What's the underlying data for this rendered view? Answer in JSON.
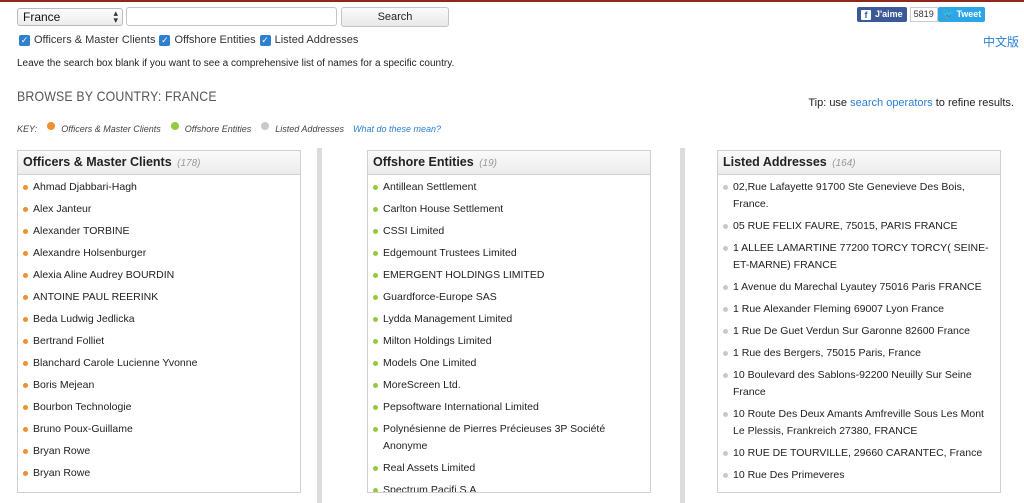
{
  "search": {
    "country_selected": "France",
    "query_value": "",
    "query_placeholder": "",
    "button_label": "Search"
  },
  "filters": [
    {
      "label": "Officers & Master Clients",
      "checked": true
    },
    {
      "label": "Offshore Entities",
      "checked": true
    },
    {
      "label": "Listed Addresses",
      "checked": true
    }
  ],
  "hint": "Leave the search box blank if you want to see a comprehensive list of names for a specific country.",
  "language_link": "中文版",
  "social": {
    "facebook_label": "J'aime",
    "facebook_count": "5819",
    "twitter_label": "Tweet"
  },
  "browse_title": "BROWSE BY COUNTRY: FRANCE",
  "tip": {
    "prefix": "Tip: use",
    "link": "search operators",
    "suffix": "to refine results."
  },
  "key": {
    "label": "KEY:",
    "items": [
      {
        "label": "Officers & Master Clients",
        "color": "#f0902e"
      },
      {
        "label": "Offshore Entities",
        "color": "#96c93d"
      },
      {
        "label": "Listed Addresses",
        "color": "#c8c8c8"
      }
    ],
    "link": "What do these mean?"
  },
  "colors": {
    "officer": "#f0902e",
    "entity": "#96c93d",
    "address": "#c8c8c8",
    "link": "#2a7fd4"
  },
  "officers": {
    "title": "Officers & Master Clients",
    "count": "(178)",
    "items": [
      "Ahmad Djabbari-Hagh",
      "Alex Janteur",
      "Alexander TORBINE",
      "Alexandre Holsenburger",
      "Alexia Aline Audrey BOURDIN",
      "ANTOINE PAUL REERINK",
      "Beda Ludwig Jedlicka",
      "Bertrand Folliet",
      "Blanchard Carole Lucienne Yvonne",
      "Boris Mejean",
      "Bourbon Technologie",
      "Bruno Poux-Guillame",
      "Bryan Rowe",
      "Bryan Rowe"
    ]
  },
  "entities": {
    "title": "Offshore Entities",
    "count": "(19)",
    "items": [
      "Antillean Settlement",
      "Carlton House Settlement",
      "CSSI Limited",
      "Edgemount Trustees Limited",
      "EMERGENT HOLDINGS LIMITED",
      "Guardforce-Europe SAS",
      "Lydda Management Limited",
      "Milton Holdings Limited",
      "Models One Limited",
      "MoreScreen Ltd.",
      "Pepsoftware International Limited",
      "Polynésienne de Pierres Précieuses 3P Société Anonyme",
      "Real Assets Limited",
      "Spectrum Pacifi S.A."
    ]
  },
  "addresses": {
    "title": "Listed Addresses",
    "count": "(164)",
    "items": [
      "02,Rue Lafayette 91700 Ste Genevieve Des Bois, France.",
      "05 RUE FELIX FAURE, 75015, PARIS FRANCE",
      "1 ALLEE LAMARTINE 77200 TORCY TORCY( SEINE-ET-MARNE) FRANCE",
      "1 Avenue du Marechal Lyautey 75016 Paris FRANCE",
      "1 Rue Alexander Fleming 69007 Lyon France",
      "1 Rue De Guet Verdun Sur Garonne 82600 France",
      "1 Rue des Bergers, 75015 Paris, France",
      "10 Boulevard des Sablons-92200 Neuilly Sur Seine France",
      "10 Route Des Deux Amants Amfreville Sous Les Mont Le Plessis, Frankreich 27380, FRANCE",
      "10 RUE DE TOURVILLE, 29660 CARANTEC, France",
      "10 Rue Des Primeveres"
    ]
  }
}
